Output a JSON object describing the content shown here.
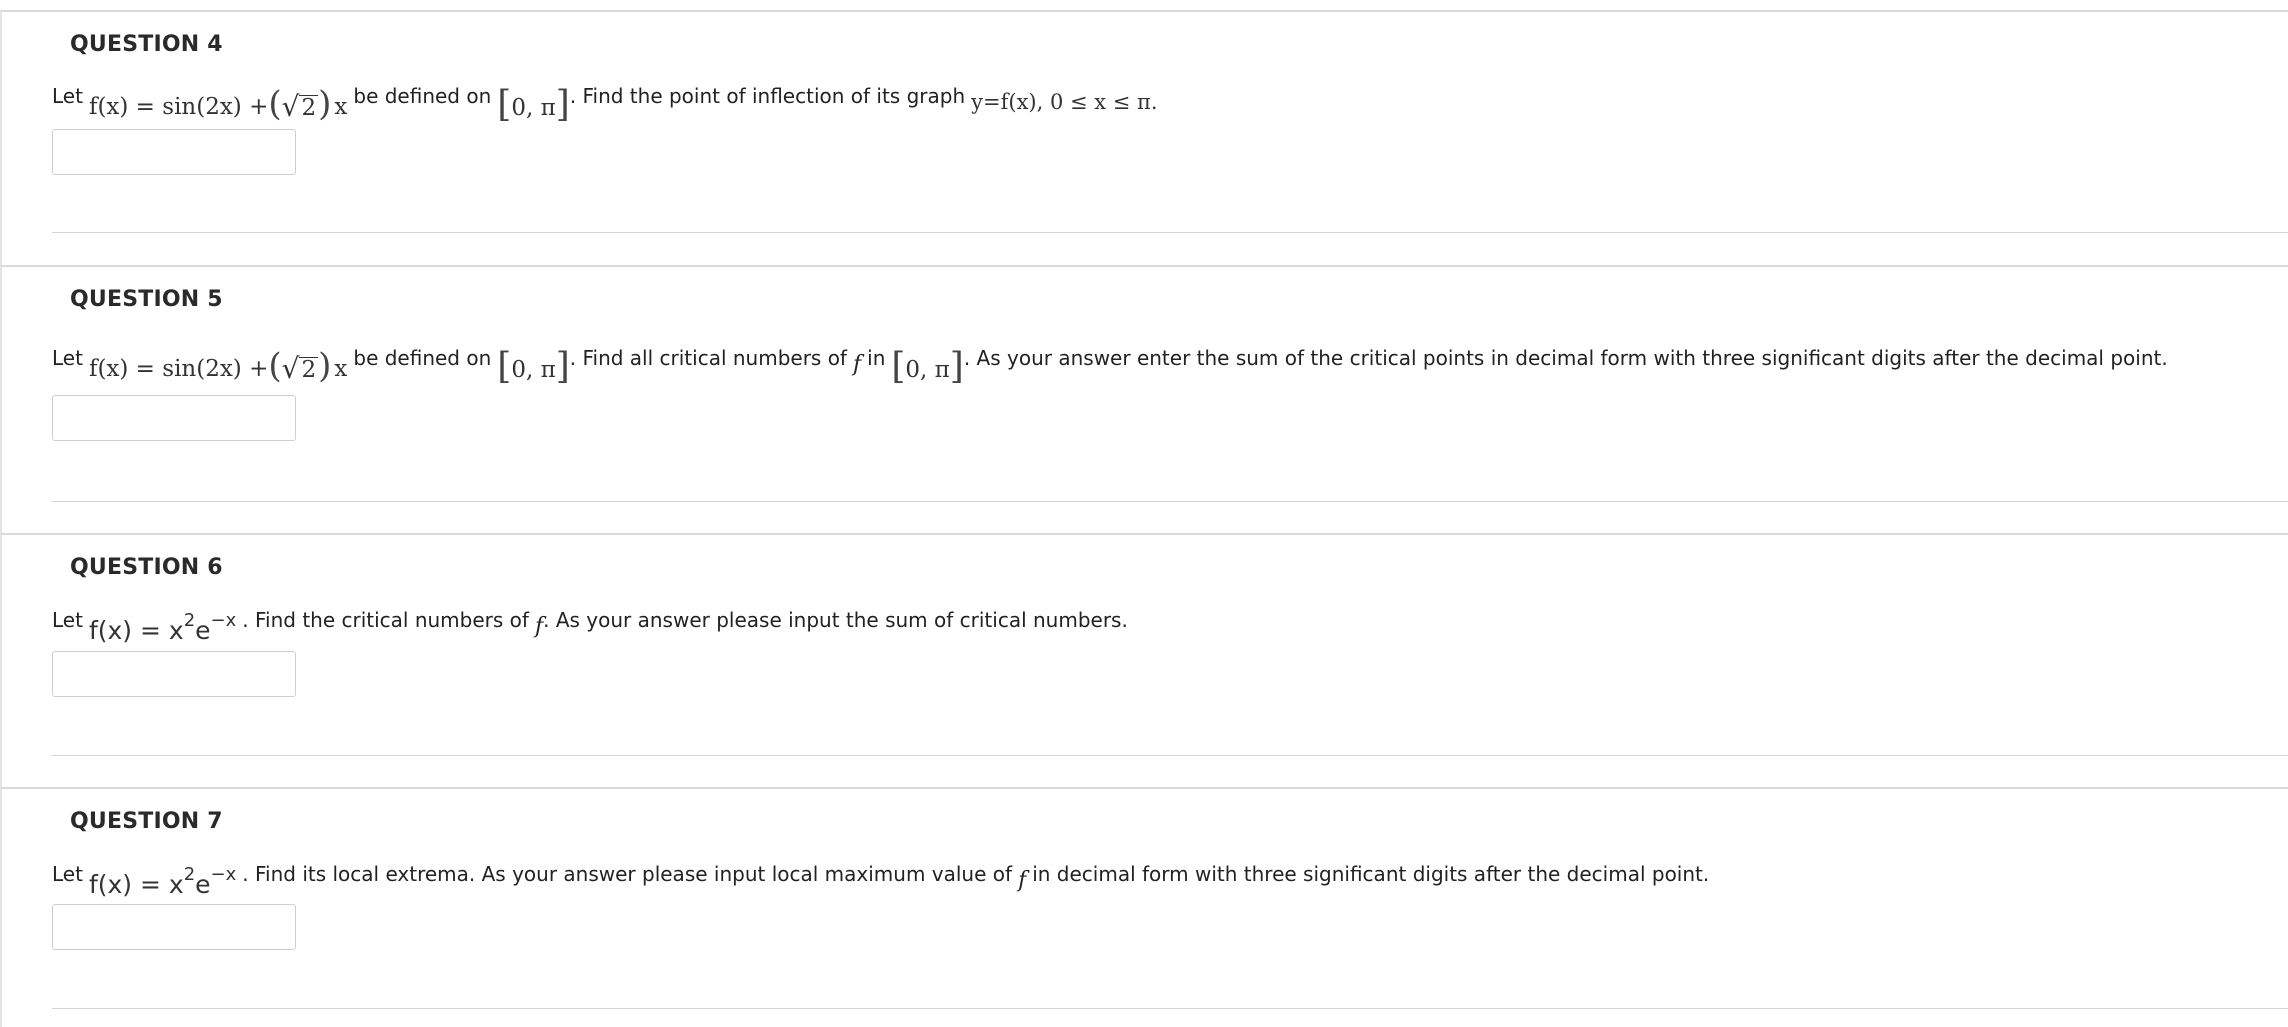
{
  "questions": [
    {
      "title": "QUESTION 4",
      "let": "Let",
      "math": {
        "fx": "f(x) = sin(2x) + ",
        "open_paren": "(",
        "root_sym": "√",
        "root_arg": "2",
        "close_paren": ")",
        "var": "x"
      },
      "mid": "be defined on",
      "interval": {
        "open": "[",
        "body": "0, π",
        "close": "]"
      },
      "text_after": ". Find the point of inflection of its graph",
      "tail_math": "y=f(x), 0 ≤ x ≤ π.",
      "answer_value": ""
    },
    {
      "title": "QUESTION 5",
      "let": "Let",
      "math": {
        "fx": "f(x) = sin(2x) + ",
        "open_paren": "(",
        "root_sym": "√",
        "root_arg": "2",
        "close_paren": ")",
        "var": "x"
      },
      "mid": "be defined on",
      "interval": {
        "open": "[",
        "body": "0, π",
        "close": "]"
      },
      "text_a": ". Find all critical numbers of",
      "fsym": "f",
      "text_in": "in",
      "interval2": {
        "open": "[",
        "body": "0, π",
        "close": "]"
      },
      "text_b": ". As your answer enter the sum of the critical points in decimal form with three significant digits after the decimal point.",
      "answer_value": ""
    },
    {
      "title": "QUESTION 6",
      "let": "Let",
      "math": {
        "fx": "f(x) = x",
        "exp1": "2",
        "e": "e",
        "exp2": "−x"
      },
      "text_a": ". Find the critical numbers of",
      "fsym": "f",
      "text_b": ". As your answer please input the sum of critical numbers.",
      "answer_value": ""
    },
    {
      "title": "QUESTION 7",
      "let": "Let",
      "math": {
        "fx": "f(x) = x",
        "exp1": "2",
        "e": "e",
        "exp2": "−x"
      },
      "text_a": ". Find its local extrema. As your answer please input local maximum value of",
      "fsym": "f",
      "text_b": "in decimal form with three significant digits after the decimal point.",
      "answer_value": ""
    }
  ]
}
